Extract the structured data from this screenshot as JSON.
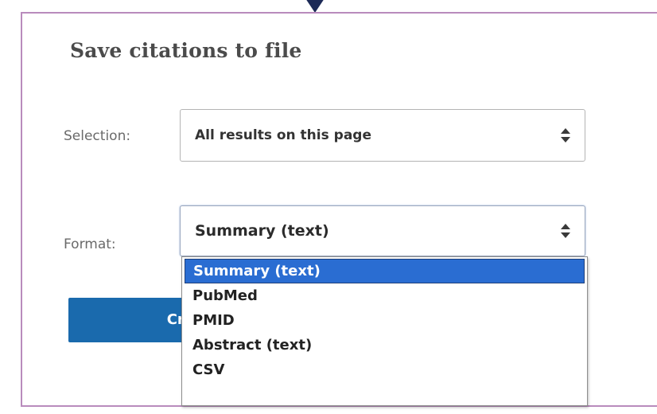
{
  "dialog": {
    "title": "Save citations to file"
  },
  "selection": {
    "label": "Selection:",
    "value": "All results on this page"
  },
  "format": {
    "label": "Format:",
    "value": "Summary (text)",
    "options": [
      "Summary (text)",
      "PubMed",
      "PMID",
      "Abstract (text)",
      "CSV"
    ],
    "highlighted_option": "Summary (text)"
  },
  "actions": {
    "create_label": "Cre"
  },
  "colors": {
    "dialog_border": "#b98bbd",
    "button": "#1a6aad",
    "highlight": "#2a6dd2",
    "pointer": "#1c2a57"
  },
  "icons": {
    "select_arrows": "updown-icon",
    "top_pointer": "pointer-arrow-icon"
  }
}
